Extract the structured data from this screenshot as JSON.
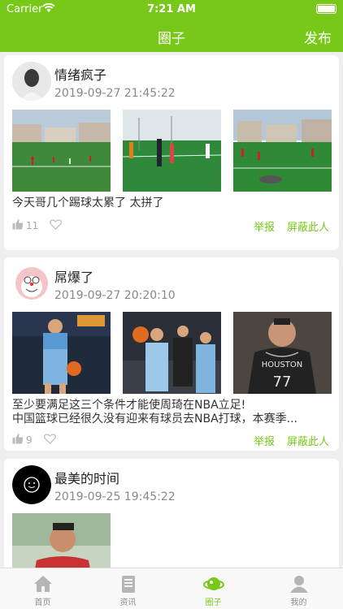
{
  "status_bar": {
    "carrier": "Carrier",
    "time": "7:21 AM"
  },
  "nav": {
    "title": "圈子",
    "publish_label": "发布"
  },
  "actions": {
    "report": "举报",
    "block": "屏蔽此人"
  },
  "posts": [
    {
      "username": "情绪疯子",
      "time": "2019-09-27 21:45:22",
      "lines": [
        "今天哥几个踢球太累了 太拼了"
      ],
      "likes": "11",
      "images": [
        "soccer-field-match",
        "soccer-field-practice",
        "soccer-field-goalkeeper"
      ]
    },
    {
      "username": "屌爆了",
      "time": "2019-09-27 20:20:10",
      "lines": [
        "至少要满足这三个条件才能使周琦在NBA立足!",
        "中国篮球已经很久没有迎来有球员去NBA打球，本赛季..."
      ],
      "likes": "9",
      "images": [
        "basketball-player-dribbling",
        "basketball-player-game",
        "basketball-player-rockets-jersey"
      ],
      "jersey_text": "HOUSTON",
      "jersey_number": "77"
    },
    {
      "username": "最美的时间",
      "time": "2019-09-25 19:45:22",
      "images": [
        "player-portrait"
      ]
    }
  ],
  "tabs": [
    {
      "label": "首页",
      "icon": "home-icon"
    },
    {
      "label": "资讯",
      "icon": "news-icon"
    },
    {
      "label": "圈子",
      "icon": "circle-icon"
    },
    {
      "label": "我的",
      "icon": "profile-icon"
    }
  ],
  "colors": {
    "accent": "#78c81a",
    "background": "#efefef"
  }
}
